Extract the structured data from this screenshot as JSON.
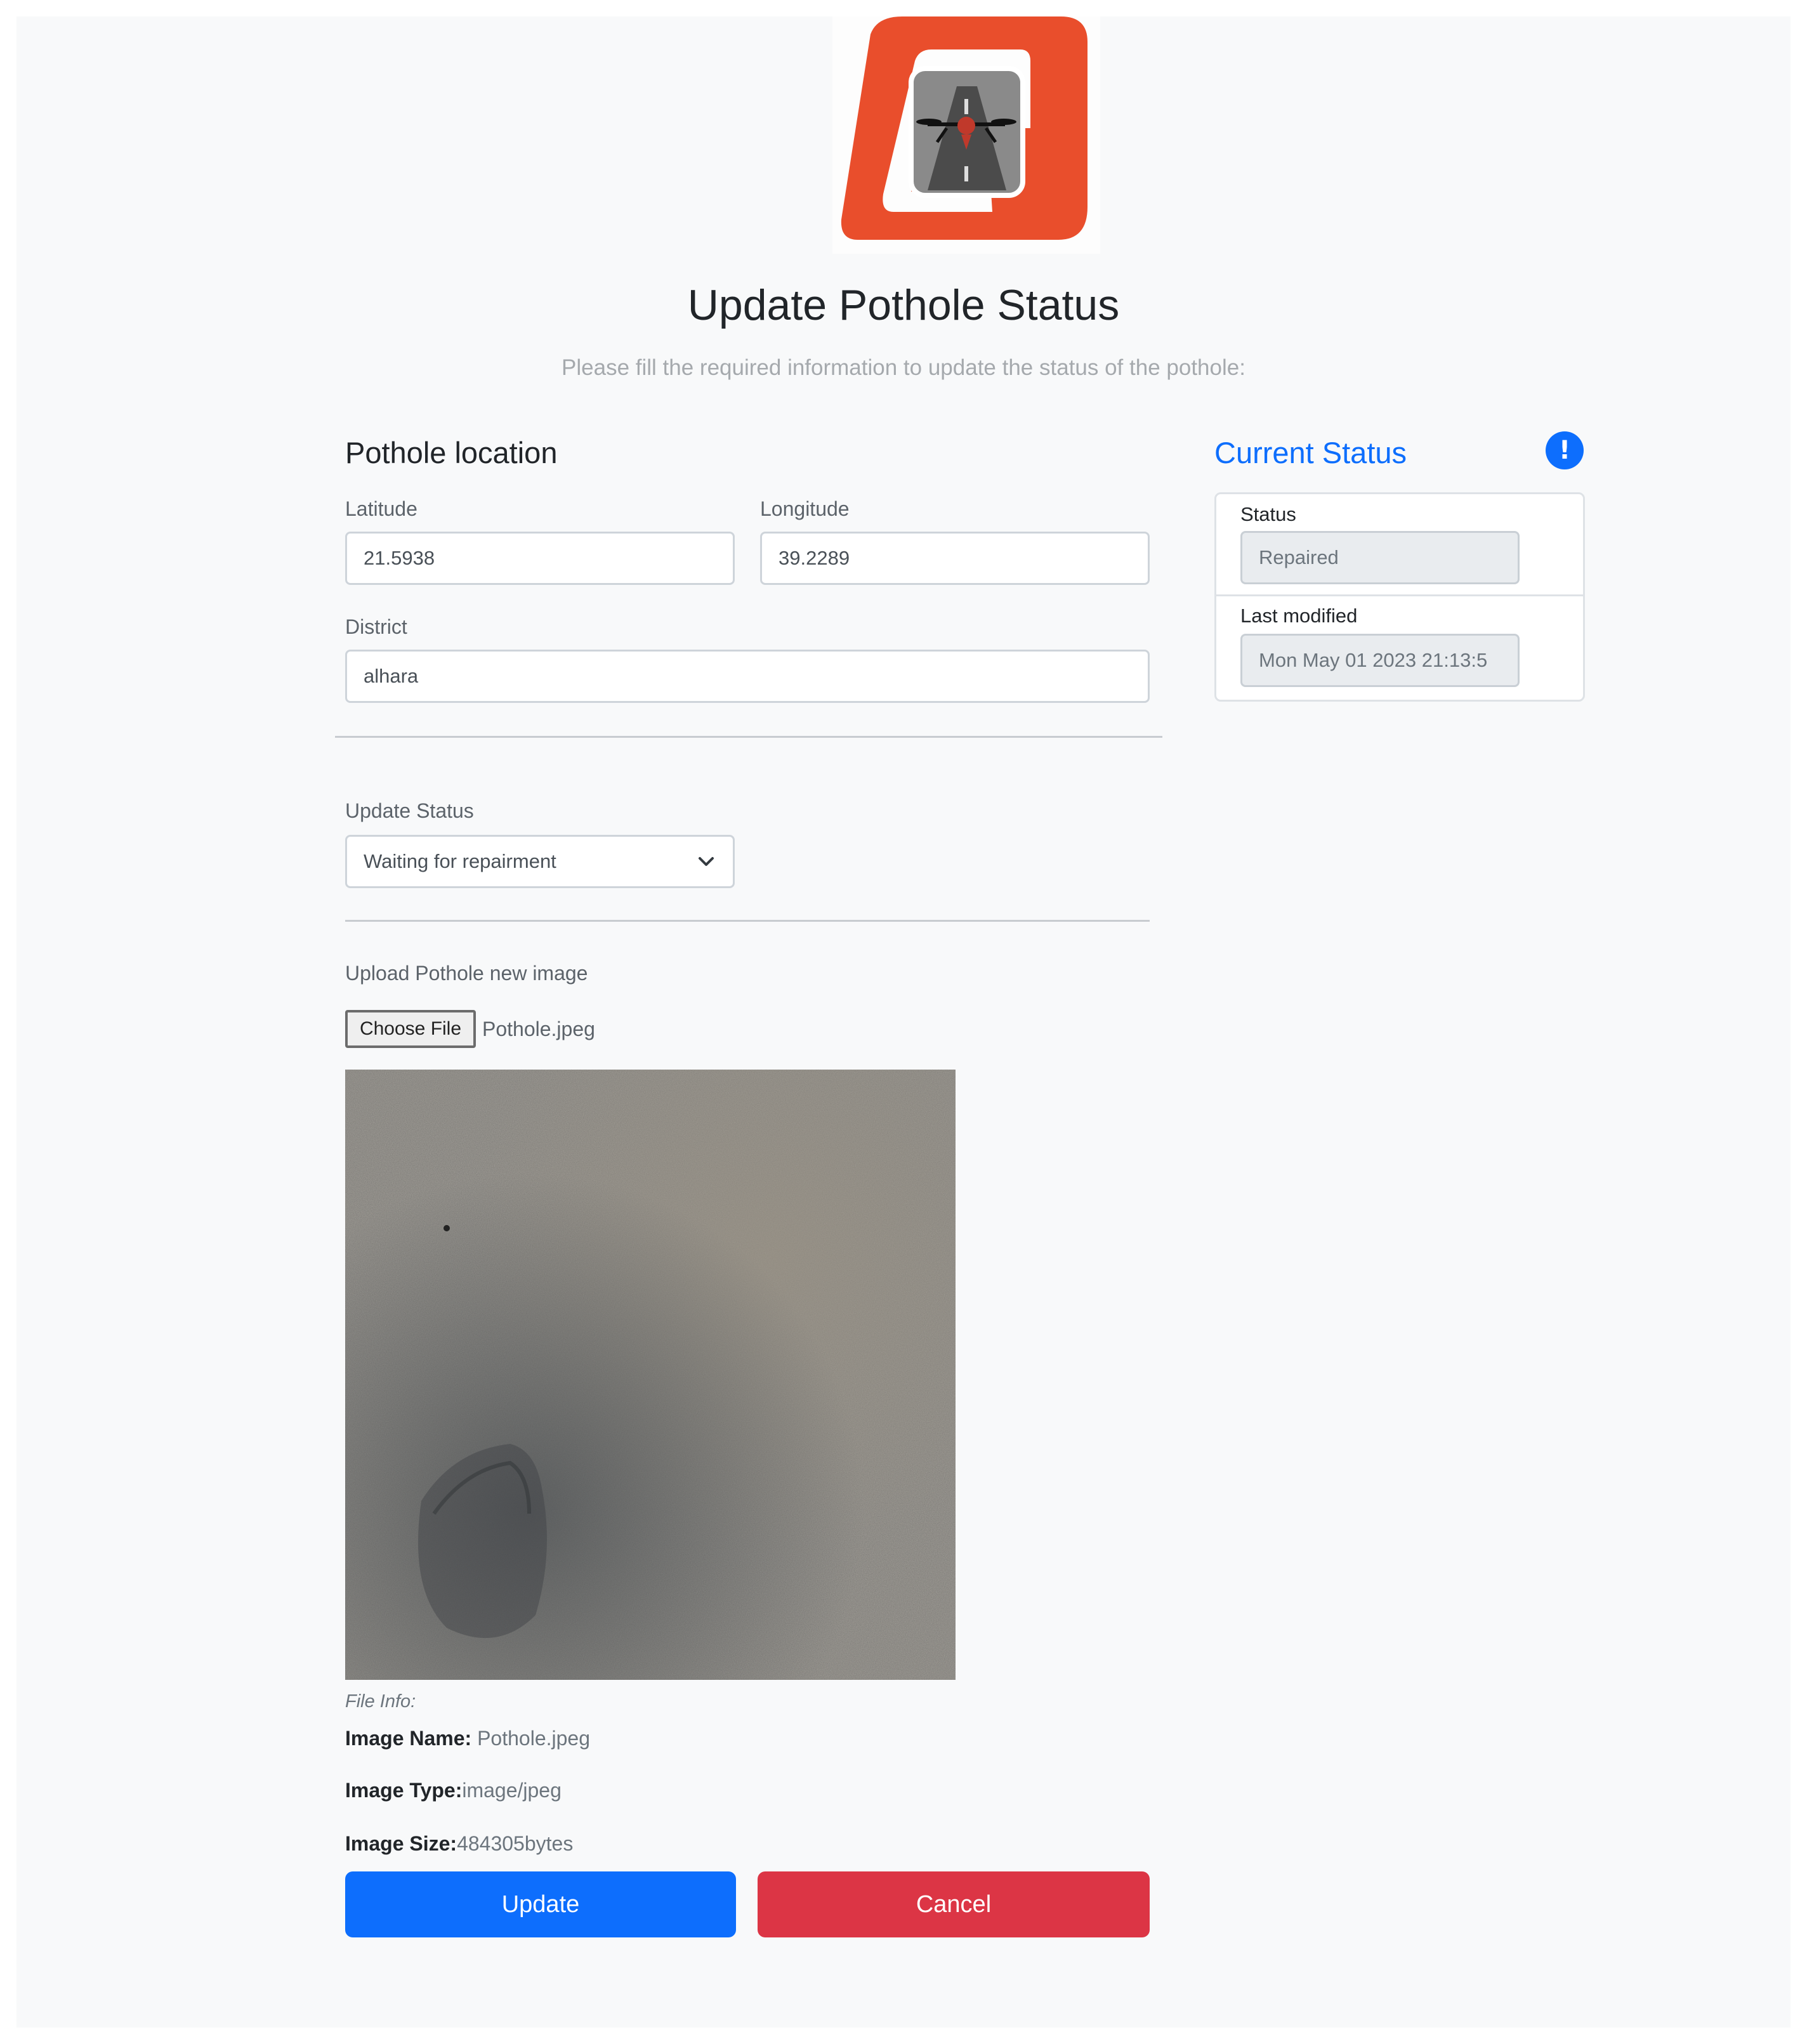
{
  "header": {
    "logo_alt": "logo",
    "title": "Update Pothole Status",
    "subtitle": "Please fill the required information to update the status of the pothole:"
  },
  "location": {
    "section_title": "Pothole location",
    "latitude_label": "Latitude",
    "latitude_value": "21.5938",
    "longitude_label": "Longitude",
    "longitude_value": "39.2289",
    "district_label": "District",
    "district_value": "alhara"
  },
  "update": {
    "status_label": "Update Status",
    "status_selected": "Waiting for repairment",
    "upload_label": "Upload Pothole new image",
    "choose_file_label": "Choose File",
    "chosen_file": "Pothole.jpeg"
  },
  "file_info": {
    "heading": "File Info:",
    "name_label": "Image Name:",
    "name_value": " Pothole.jpeg",
    "type_label": "Image Type:",
    "type_value": "image/jpeg",
    "size_label": "Image Size:",
    "size_value": "484305bytes"
  },
  "current_status": {
    "title": "Current Status",
    "info_icon": "exclamation-circle-icon",
    "status_label": "Status",
    "status_value": "Repaired",
    "last_modified_label": "Last modified",
    "last_modified_value": "Mon May 01 2023 21:13:5"
  },
  "actions": {
    "update_label": "Update",
    "cancel_label": "Cancel"
  },
  "colors": {
    "primary": "#0d6efd",
    "danger": "#dc3545",
    "logo_orange": "#e94e2c",
    "background": "#f8f9fa"
  }
}
